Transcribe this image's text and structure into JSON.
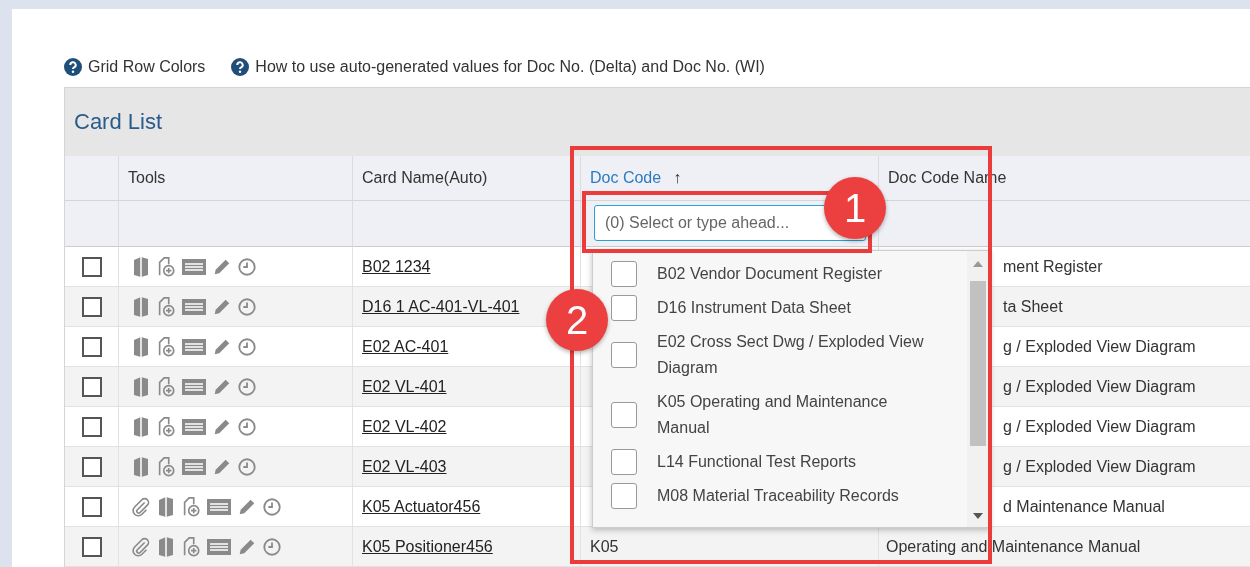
{
  "help_links": [
    {
      "label": "Grid Row Colors"
    },
    {
      "label": "How to use auto-generated values for Doc No. (Delta) and Doc No. (WI)"
    }
  ],
  "panel": {
    "title": "Card List"
  },
  "table": {
    "columns": [
      {
        "label": "Tools",
        "sorted": false
      },
      {
        "label": "Card Name(Auto)",
        "sorted": false
      },
      {
        "label": "Doc Code",
        "sorted": true,
        "sort_arrow": "↑"
      },
      {
        "label": "Doc Code Name",
        "sorted": false
      }
    ],
    "filter": {
      "placeholder": "(0) Select or type ahead..."
    },
    "rows": [
      {
        "checked": false,
        "attachment": false,
        "card_name": "B02 1234",
        "doc_code_name": "ment Register"
      },
      {
        "checked": false,
        "attachment": false,
        "card_name": "D16 1 AC-401-VL-401",
        "doc_code_name": "ta Sheet"
      },
      {
        "checked": false,
        "attachment": false,
        "card_name": "E02 AC-401",
        "doc_code_name": "g / Exploded View Diagram"
      },
      {
        "checked": false,
        "attachment": false,
        "card_name": "E02 VL-401",
        "doc_code_name": "g / Exploded View Diagram"
      },
      {
        "checked": false,
        "attachment": false,
        "card_name": "E02 VL-402",
        "doc_code_name": "g / Exploded View Diagram"
      },
      {
        "checked": false,
        "attachment": false,
        "card_name": "E02 VL-403",
        "doc_code_name": "g / Exploded View Diagram"
      },
      {
        "checked": false,
        "attachment": true,
        "card_name": "K05 Actuator456",
        "doc_code_name": "d Maintenance Manual"
      },
      {
        "checked": false,
        "attachment": true,
        "card_name": "K05 Positioner456",
        "doc_code": "K05",
        "doc_code_name": "Operating and Maintenance Manual"
      }
    ]
  },
  "dropdown": {
    "options": [
      {
        "label": "B02 Vendor Document Register",
        "checked": false
      },
      {
        "label": "D16 Instrument Data Sheet",
        "checked": false
      },
      {
        "label": "E02 Cross Sect Dwg / Exploded View Diagram",
        "checked": false
      },
      {
        "label": "K05 Operating and Maintenance Manual",
        "checked": false
      },
      {
        "label": "L14 Functional Test Reports",
        "checked": false
      },
      {
        "label": "M08 Material Traceability Records",
        "checked": false
      }
    ]
  },
  "annotations": [
    {
      "label": "1"
    },
    {
      "label": "2"
    }
  ]
}
